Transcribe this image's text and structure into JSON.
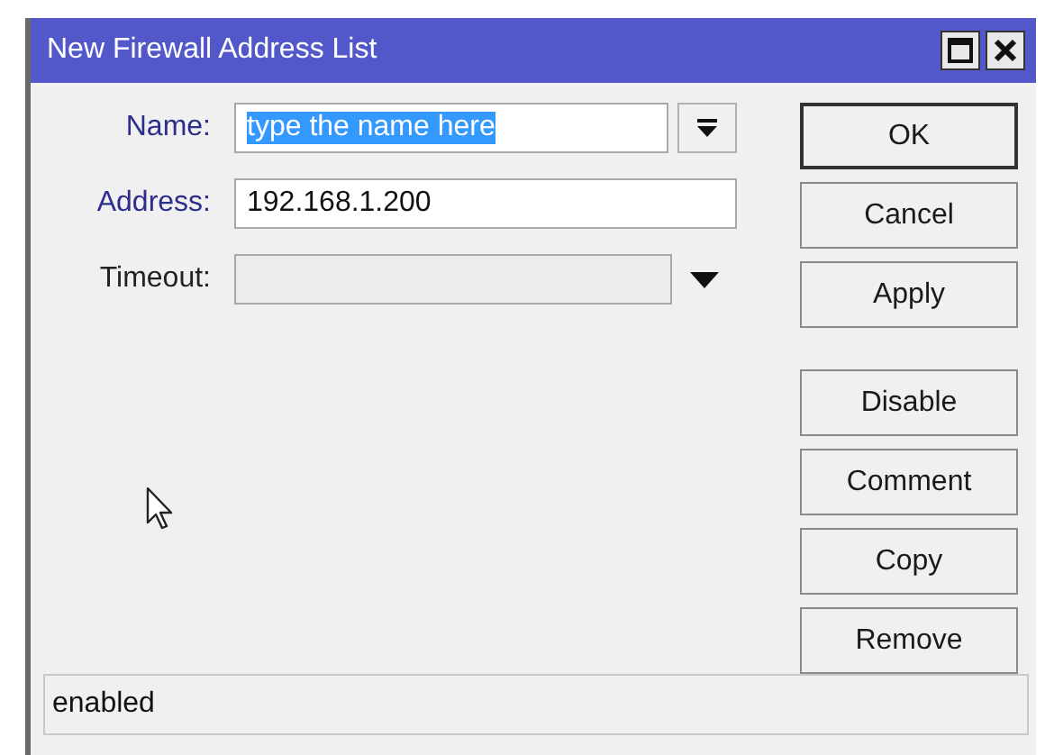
{
  "window": {
    "title": "New Firewall Address List"
  },
  "fields": [
    {
      "label": "Name:",
      "kind": "dropdown",
      "value": "type the name here",
      "text_selected": true,
      "highlighted": true,
      "disabled": false
    },
    {
      "label": "Address:",
      "kind": "text",
      "value": "192.168.1.200",
      "text_selected": false,
      "highlighted": true,
      "disabled": false
    },
    {
      "label": "Timeout:",
      "kind": "arrow",
      "highlighted": false,
      "disabled": true
    }
  ],
  "button_groups": [
    [
      {
        "label": "OK",
        "default": true
      },
      {
        "label": "Cancel",
        "default": false
      },
      {
        "label": "Apply",
        "default": false
      }
    ],
    [
      {
        "label": "Disable",
        "default": false
      },
      {
        "label": "Comment",
        "default": false
      },
      {
        "label": "Copy",
        "default": false
      },
      {
        "label": "Remove",
        "default": false
      }
    ]
  ],
  "status_bar": {
    "text": "enabled"
  }
}
